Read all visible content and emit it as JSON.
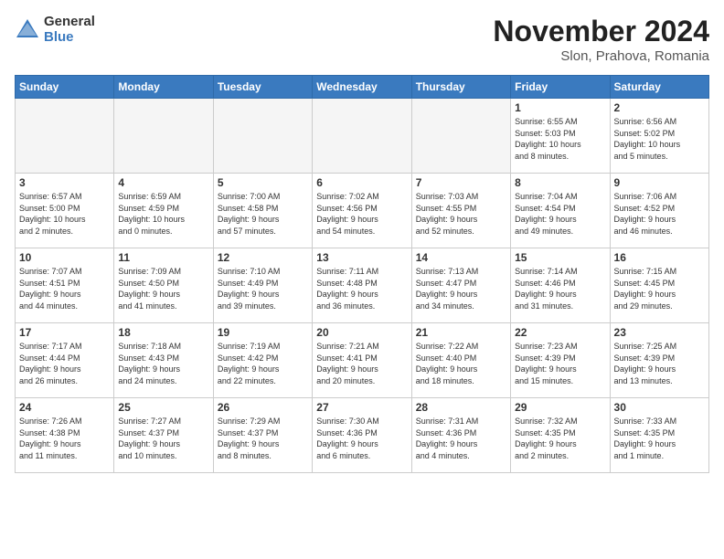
{
  "logo": {
    "general": "General",
    "blue": "Blue"
  },
  "title": "November 2024",
  "location": "Slon, Prahova, Romania",
  "weekdays": [
    "Sunday",
    "Monday",
    "Tuesday",
    "Wednesday",
    "Thursday",
    "Friday",
    "Saturday"
  ],
  "weeks": [
    [
      {
        "day": "",
        "info": "",
        "empty": true
      },
      {
        "day": "",
        "info": "",
        "empty": true
      },
      {
        "day": "",
        "info": "",
        "empty": true
      },
      {
        "day": "",
        "info": "",
        "empty": true
      },
      {
        "day": "",
        "info": "",
        "empty": true
      },
      {
        "day": "1",
        "info": "Sunrise: 6:55 AM\nSunset: 5:03 PM\nDaylight: 10 hours\nand 8 minutes.",
        "empty": false
      },
      {
        "day": "2",
        "info": "Sunrise: 6:56 AM\nSunset: 5:02 PM\nDaylight: 10 hours\nand 5 minutes.",
        "empty": false
      }
    ],
    [
      {
        "day": "3",
        "info": "Sunrise: 6:57 AM\nSunset: 5:00 PM\nDaylight: 10 hours\nand 2 minutes.",
        "empty": false
      },
      {
        "day": "4",
        "info": "Sunrise: 6:59 AM\nSunset: 4:59 PM\nDaylight: 10 hours\nand 0 minutes.",
        "empty": false
      },
      {
        "day": "5",
        "info": "Sunrise: 7:00 AM\nSunset: 4:58 PM\nDaylight: 9 hours\nand 57 minutes.",
        "empty": false
      },
      {
        "day": "6",
        "info": "Sunrise: 7:02 AM\nSunset: 4:56 PM\nDaylight: 9 hours\nand 54 minutes.",
        "empty": false
      },
      {
        "day": "7",
        "info": "Sunrise: 7:03 AM\nSunset: 4:55 PM\nDaylight: 9 hours\nand 52 minutes.",
        "empty": false
      },
      {
        "day": "8",
        "info": "Sunrise: 7:04 AM\nSunset: 4:54 PM\nDaylight: 9 hours\nand 49 minutes.",
        "empty": false
      },
      {
        "day": "9",
        "info": "Sunrise: 7:06 AM\nSunset: 4:52 PM\nDaylight: 9 hours\nand 46 minutes.",
        "empty": false
      }
    ],
    [
      {
        "day": "10",
        "info": "Sunrise: 7:07 AM\nSunset: 4:51 PM\nDaylight: 9 hours\nand 44 minutes.",
        "empty": false
      },
      {
        "day": "11",
        "info": "Sunrise: 7:09 AM\nSunset: 4:50 PM\nDaylight: 9 hours\nand 41 minutes.",
        "empty": false
      },
      {
        "day": "12",
        "info": "Sunrise: 7:10 AM\nSunset: 4:49 PM\nDaylight: 9 hours\nand 39 minutes.",
        "empty": false
      },
      {
        "day": "13",
        "info": "Sunrise: 7:11 AM\nSunset: 4:48 PM\nDaylight: 9 hours\nand 36 minutes.",
        "empty": false
      },
      {
        "day": "14",
        "info": "Sunrise: 7:13 AM\nSunset: 4:47 PM\nDaylight: 9 hours\nand 34 minutes.",
        "empty": false
      },
      {
        "day": "15",
        "info": "Sunrise: 7:14 AM\nSunset: 4:46 PM\nDaylight: 9 hours\nand 31 minutes.",
        "empty": false
      },
      {
        "day": "16",
        "info": "Sunrise: 7:15 AM\nSunset: 4:45 PM\nDaylight: 9 hours\nand 29 minutes.",
        "empty": false
      }
    ],
    [
      {
        "day": "17",
        "info": "Sunrise: 7:17 AM\nSunset: 4:44 PM\nDaylight: 9 hours\nand 26 minutes.",
        "empty": false
      },
      {
        "day": "18",
        "info": "Sunrise: 7:18 AM\nSunset: 4:43 PM\nDaylight: 9 hours\nand 24 minutes.",
        "empty": false
      },
      {
        "day": "19",
        "info": "Sunrise: 7:19 AM\nSunset: 4:42 PM\nDaylight: 9 hours\nand 22 minutes.",
        "empty": false
      },
      {
        "day": "20",
        "info": "Sunrise: 7:21 AM\nSunset: 4:41 PM\nDaylight: 9 hours\nand 20 minutes.",
        "empty": false
      },
      {
        "day": "21",
        "info": "Sunrise: 7:22 AM\nSunset: 4:40 PM\nDaylight: 9 hours\nand 18 minutes.",
        "empty": false
      },
      {
        "day": "22",
        "info": "Sunrise: 7:23 AM\nSunset: 4:39 PM\nDaylight: 9 hours\nand 15 minutes.",
        "empty": false
      },
      {
        "day": "23",
        "info": "Sunrise: 7:25 AM\nSunset: 4:39 PM\nDaylight: 9 hours\nand 13 minutes.",
        "empty": false
      }
    ],
    [
      {
        "day": "24",
        "info": "Sunrise: 7:26 AM\nSunset: 4:38 PM\nDaylight: 9 hours\nand 11 minutes.",
        "empty": false
      },
      {
        "day": "25",
        "info": "Sunrise: 7:27 AM\nSunset: 4:37 PM\nDaylight: 9 hours\nand 10 minutes.",
        "empty": false
      },
      {
        "day": "26",
        "info": "Sunrise: 7:29 AM\nSunset: 4:37 PM\nDaylight: 9 hours\nand 8 minutes.",
        "empty": false
      },
      {
        "day": "27",
        "info": "Sunrise: 7:30 AM\nSunset: 4:36 PM\nDaylight: 9 hours\nand 6 minutes.",
        "empty": false
      },
      {
        "day": "28",
        "info": "Sunrise: 7:31 AM\nSunset: 4:36 PM\nDaylight: 9 hours\nand 4 minutes.",
        "empty": false
      },
      {
        "day": "29",
        "info": "Sunrise: 7:32 AM\nSunset: 4:35 PM\nDaylight: 9 hours\nand 2 minutes.",
        "empty": false
      },
      {
        "day": "30",
        "info": "Sunrise: 7:33 AM\nSunset: 4:35 PM\nDaylight: 9 hours\nand 1 minute.",
        "empty": false
      }
    ]
  ]
}
